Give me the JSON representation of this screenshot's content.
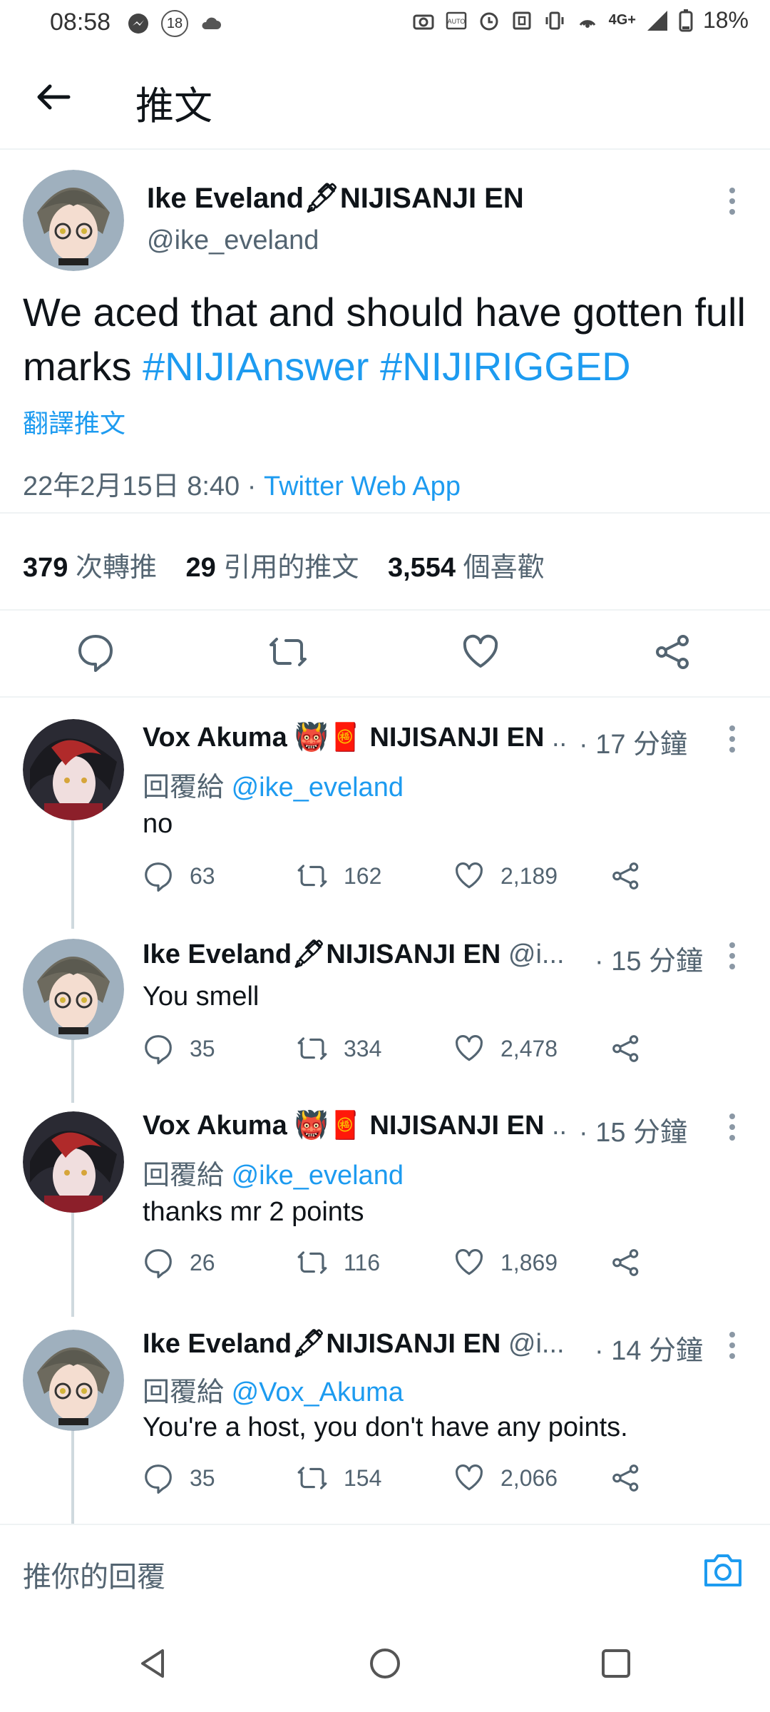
{
  "status_bar": {
    "time": "08:58",
    "notification_count": "18",
    "network": "4G+",
    "battery": "18%"
  },
  "header": {
    "title": "推文"
  },
  "main_tweet": {
    "author_name": "Ike Eveland🖋NIJISANJI EN",
    "author_handle": "@ike_eveland",
    "text_plain": "We aced that and should have gotten full marks ",
    "hashtag1": "#NIJIAnswer",
    "hashtag2": "#NIJIRIGGED",
    "translate_label": "翻譯推文",
    "timestamp": "22年2月15日 8:40",
    "dot": " · ",
    "source": "Twitter Web App",
    "retweets_count": "379",
    "retweets_label": " 次轉推",
    "quotes_count": "29",
    "quotes_label": " 引用的推文",
    "likes_count": "3,554",
    "likes_label": " 個喜歡"
  },
  "replies": [
    {
      "name": "Vox Akuma 👹🧧 NIJISANJI EN",
      "name_suffix": " ..",
      "time": "· 17 分鐘",
      "reply_to_label": "回覆給 ",
      "reply_to_handle": "@ike_eveland",
      "text": "no",
      "reply_count": "63",
      "retweet_count": "162",
      "like_count": "2,189"
    },
    {
      "name": "Ike Eveland🖋NIJISANJI EN",
      "name_suffix": " @i...",
      "time": "· 15 分鐘",
      "reply_to_label": "",
      "reply_to_handle": "",
      "text": "You smell",
      "reply_count": "35",
      "retweet_count": "334",
      "like_count": "2,478"
    },
    {
      "name": "Vox Akuma 👹🧧 NIJISANJI EN",
      "name_suffix": " ..",
      "time": "· 15 分鐘",
      "reply_to_label": "回覆給 ",
      "reply_to_handle": "@ike_eveland",
      "text": "thanks mr 2 points",
      "reply_count": "26",
      "retweet_count": "116",
      "like_count": "1,869"
    },
    {
      "name": "Ike Eveland🖋NIJISANJI EN",
      "name_suffix": " @i...",
      "time": "· 14 分鐘",
      "reply_to_label": "回覆給 ",
      "reply_to_handle": "@Vox_Akuma",
      "text": "You're a host, you don't have any points.",
      "reply_count": "35",
      "retweet_count": "154",
      "like_count": "2,066"
    }
  ],
  "reply_input": {
    "placeholder": "推你的回覆"
  },
  "colors": {
    "link": "#1d9bf0",
    "secondary_text": "#536471",
    "divider": "#eff3f4"
  }
}
